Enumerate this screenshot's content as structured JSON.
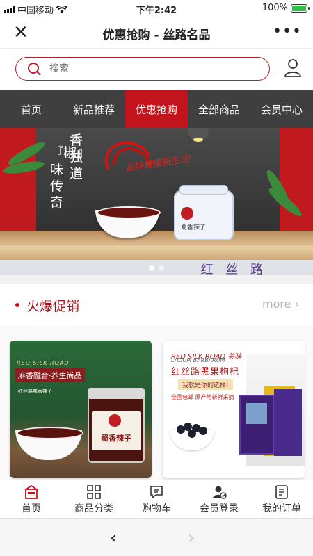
{
  "status_bar": {
    "carrier": "中国移动",
    "time": "下午2:42",
    "battery": "100%"
  },
  "navbar": {
    "title": "优惠抢购 - 丝路名品",
    "close_icon": "close-icon",
    "more_icon": "more-icon"
  },
  "search": {
    "placeholder": "搜索",
    "icon": "search-icon"
  },
  "tabs": [
    {
      "label": "首页",
      "active": false
    },
    {
      "label": "新品推荐",
      "active": false
    },
    {
      "label": "优惠抢购",
      "active": true
    },
    {
      "label": "全部商品",
      "active": false
    },
    {
      "label": "会员中心",
      "active": false
    }
  ],
  "banner": {
    "vertical_col1": "香独道",
    "vertical_col2": "『椒』味传奇",
    "slogan": "品味健康新生活!",
    "bottom_text": "红 丝 路",
    "jar_label": "蜀香辣子"
  },
  "section": {
    "title": "火爆促销",
    "more_label": "more"
  },
  "products": [
    {
      "en_title": "RED SILK ROAD",
      "title": "麻香融合·养生尚品",
      "subtitle": "红丝路蜀香辣子",
      "jar_label": "蜀香辣子"
    },
    {
      "en_title": "RED SILK ROAD 美味",
      "en_sub": "LYCIUM BARBARUM",
      "title": "红丝路黑果枸杞",
      "badge": "我就是你的选择!",
      "line": "全国包邮 原产地新鲜采摘"
    }
  ],
  "bottom_nav": [
    {
      "label": "首页",
      "icon": "home-icon"
    },
    {
      "label": "商品分类",
      "icon": "category-icon"
    },
    {
      "label": "购物车",
      "icon": "cart-icon"
    },
    {
      "label": "会员登录",
      "icon": "member-icon"
    },
    {
      "label": "我的订单",
      "icon": "order-icon"
    }
  ],
  "colors": {
    "brand_red": "#c3141d",
    "tab_bg": "#3f3f3f"
  }
}
